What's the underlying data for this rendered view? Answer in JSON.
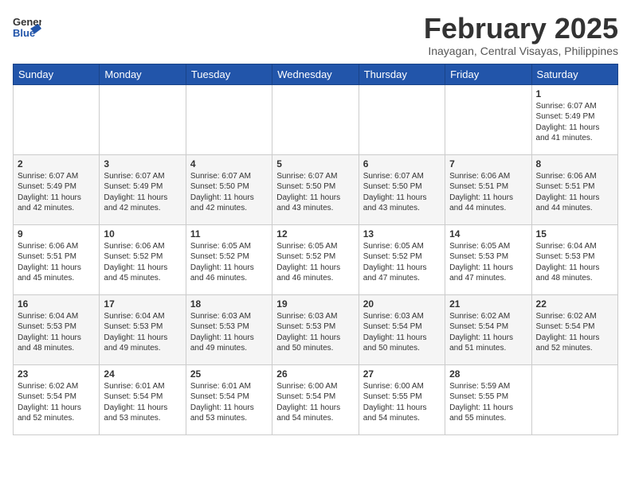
{
  "header": {
    "logo": {
      "general": "General",
      "blue": "Blue"
    },
    "title": "February 2025",
    "location": "Inayagan, Central Visayas, Philippines"
  },
  "days_of_week": [
    "Sunday",
    "Monday",
    "Tuesday",
    "Wednesday",
    "Thursday",
    "Friday",
    "Saturday"
  ],
  "weeks": [
    [
      {
        "day": "",
        "info": ""
      },
      {
        "day": "",
        "info": ""
      },
      {
        "day": "",
        "info": ""
      },
      {
        "day": "",
        "info": ""
      },
      {
        "day": "",
        "info": ""
      },
      {
        "day": "",
        "info": ""
      },
      {
        "day": "1",
        "info": "Sunrise: 6:07 AM\nSunset: 5:49 PM\nDaylight: 11 hours and 41 minutes."
      }
    ],
    [
      {
        "day": "2",
        "info": "Sunrise: 6:07 AM\nSunset: 5:49 PM\nDaylight: 11 hours and 42 minutes."
      },
      {
        "day": "3",
        "info": "Sunrise: 6:07 AM\nSunset: 5:49 PM\nDaylight: 11 hours and 42 minutes."
      },
      {
        "day": "4",
        "info": "Sunrise: 6:07 AM\nSunset: 5:50 PM\nDaylight: 11 hours and 42 minutes."
      },
      {
        "day": "5",
        "info": "Sunrise: 6:07 AM\nSunset: 5:50 PM\nDaylight: 11 hours and 43 minutes."
      },
      {
        "day": "6",
        "info": "Sunrise: 6:07 AM\nSunset: 5:50 PM\nDaylight: 11 hours and 43 minutes."
      },
      {
        "day": "7",
        "info": "Sunrise: 6:06 AM\nSunset: 5:51 PM\nDaylight: 11 hours and 44 minutes."
      },
      {
        "day": "8",
        "info": "Sunrise: 6:06 AM\nSunset: 5:51 PM\nDaylight: 11 hours and 44 minutes."
      }
    ],
    [
      {
        "day": "9",
        "info": "Sunrise: 6:06 AM\nSunset: 5:51 PM\nDaylight: 11 hours and 45 minutes."
      },
      {
        "day": "10",
        "info": "Sunrise: 6:06 AM\nSunset: 5:52 PM\nDaylight: 11 hours and 45 minutes."
      },
      {
        "day": "11",
        "info": "Sunrise: 6:05 AM\nSunset: 5:52 PM\nDaylight: 11 hours and 46 minutes."
      },
      {
        "day": "12",
        "info": "Sunrise: 6:05 AM\nSunset: 5:52 PM\nDaylight: 11 hours and 46 minutes."
      },
      {
        "day": "13",
        "info": "Sunrise: 6:05 AM\nSunset: 5:52 PM\nDaylight: 11 hours and 47 minutes."
      },
      {
        "day": "14",
        "info": "Sunrise: 6:05 AM\nSunset: 5:53 PM\nDaylight: 11 hours and 47 minutes."
      },
      {
        "day": "15",
        "info": "Sunrise: 6:04 AM\nSunset: 5:53 PM\nDaylight: 11 hours and 48 minutes."
      }
    ],
    [
      {
        "day": "16",
        "info": "Sunrise: 6:04 AM\nSunset: 5:53 PM\nDaylight: 11 hours and 48 minutes."
      },
      {
        "day": "17",
        "info": "Sunrise: 6:04 AM\nSunset: 5:53 PM\nDaylight: 11 hours and 49 minutes."
      },
      {
        "day": "18",
        "info": "Sunrise: 6:03 AM\nSunset: 5:53 PM\nDaylight: 11 hours and 49 minutes."
      },
      {
        "day": "19",
        "info": "Sunrise: 6:03 AM\nSunset: 5:53 PM\nDaylight: 11 hours and 50 minutes."
      },
      {
        "day": "20",
        "info": "Sunrise: 6:03 AM\nSunset: 5:54 PM\nDaylight: 11 hours and 50 minutes."
      },
      {
        "day": "21",
        "info": "Sunrise: 6:02 AM\nSunset: 5:54 PM\nDaylight: 11 hours and 51 minutes."
      },
      {
        "day": "22",
        "info": "Sunrise: 6:02 AM\nSunset: 5:54 PM\nDaylight: 11 hours and 52 minutes."
      }
    ],
    [
      {
        "day": "23",
        "info": "Sunrise: 6:02 AM\nSunset: 5:54 PM\nDaylight: 11 hours and 52 minutes."
      },
      {
        "day": "24",
        "info": "Sunrise: 6:01 AM\nSunset: 5:54 PM\nDaylight: 11 hours and 53 minutes."
      },
      {
        "day": "25",
        "info": "Sunrise: 6:01 AM\nSunset: 5:54 PM\nDaylight: 11 hours and 53 minutes."
      },
      {
        "day": "26",
        "info": "Sunrise: 6:00 AM\nSunset: 5:54 PM\nDaylight: 11 hours and 54 minutes."
      },
      {
        "day": "27",
        "info": "Sunrise: 6:00 AM\nSunset: 5:55 PM\nDaylight: 11 hours and 54 minutes."
      },
      {
        "day": "28",
        "info": "Sunrise: 5:59 AM\nSunset: 5:55 PM\nDaylight: 11 hours and 55 minutes."
      },
      {
        "day": "",
        "info": ""
      }
    ]
  ]
}
